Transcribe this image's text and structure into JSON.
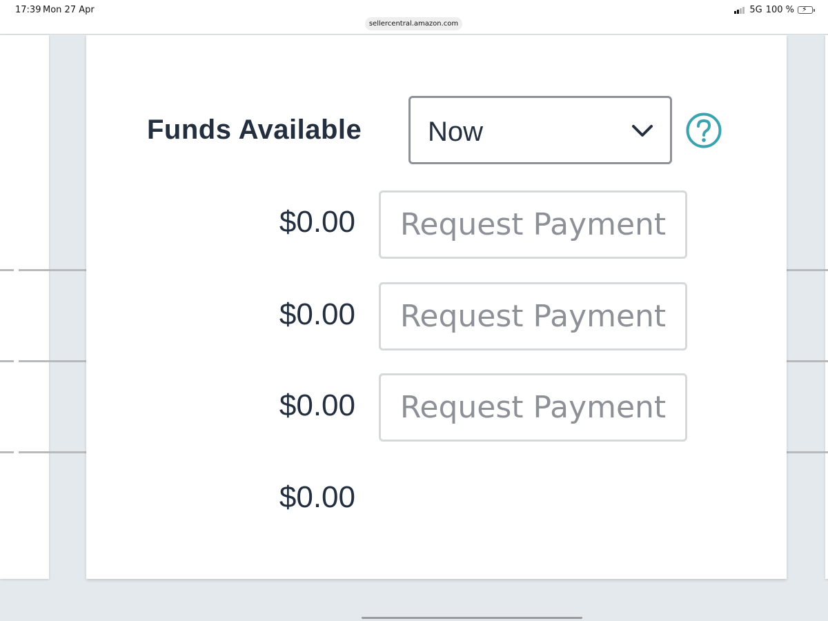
{
  "status_bar": {
    "time": "17:39",
    "date": "Mon 27 Apr",
    "network": "5G",
    "battery": "100 %"
  },
  "browser": {
    "url": "sellercentral.amazon.com"
  },
  "funds": {
    "label": "Funds Available",
    "filter": {
      "selected": "Now"
    },
    "rows": [
      {
        "amount": "$0.00",
        "button_label": "Request Payment"
      },
      {
        "amount": "$0.00",
        "button_label": "Request Payment"
      },
      {
        "amount": "$0.00",
        "button_label": "Request Payment"
      },
      {
        "amount": "$0.00"
      }
    ]
  },
  "colors": {
    "text": "#232f3e",
    "help_accent": "#3aa3af",
    "disabled_text": "#8d9096",
    "background": "#e3e9ec"
  }
}
